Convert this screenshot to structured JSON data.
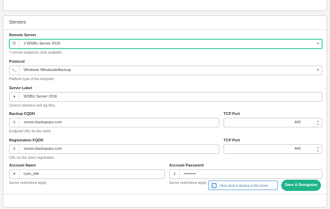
{
  "panel": {
    "title": "Servers"
  },
  "remote_server": {
    "label": "Remote Server",
    "value": "2 WSBU Server 2016",
    "help": "7 remote endpoints slots available."
  },
  "protocol": {
    "label": "Protocol",
    "value": "Windows WholesaleBackup",
    "help": "Platform type of the endpoint."
  },
  "server_label": {
    "label": "Server Label",
    "value": "WSBU Server 2016",
    "help": "Used in interface and log files."
  },
  "backup_fqdn": {
    "label": "Backup FQDN",
    "value": "server.backupops.com",
    "help": "Endpoint URL for the client."
  },
  "backup_port": {
    "label": "TCP Port",
    "value": "443"
  },
  "registration_fqdn": {
    "label": "Registration FQDN",
    "value": "server.backupops.com",
    "help": "URL for the client registration."
  },
  "registration_port": {
    "label": "TCP Port",
    "value": "443"
  },
  "account_name": {
    "label": "Account Name",
    "value": "ryan_kite",
    "help": "Server restrictions apply."
  },
  "account_password": {
    "label": "Account Password",
    "value": "•••••••••",
    "help": "Server restrictions apply."
  },
  "footer": {
    "checkbox_label": "Allow client to backup to this server",
    "checkbox_checked": true,
    "submit_label": "Save & Reregister"
  },
  "colors": {
    "accent": "#1fb48a",
    "focus": "#2ecc9a",
    "checkbox": "#3a84c9"
  },
  "icons": {
    "remote_server": "list-icon",
    "protocol": "terminal-icon",
    "server_label": "tag-icon",
    "backup_fqdn": "anchor-icon",
    "registration_fqdn": "anchor-icon",
    "account_name": "user-icon",
    "account_password": "key-icon"
  }
}
